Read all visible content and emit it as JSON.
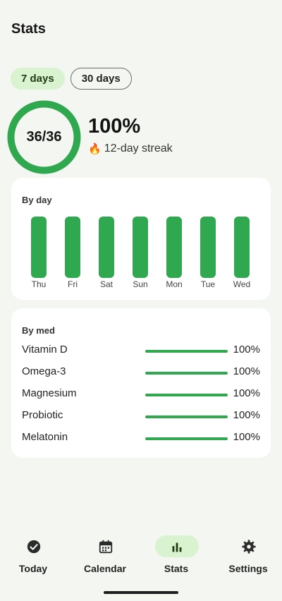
{
  "page": {
    "title": "Stats"
  },
  "range_tabs": [
    {
      "label": "7 days",
      "active": true
    },
    {
      "label": "30 days",
      "active": false
    }
  ],
  "summary": {
    "ring_label": "36/36",
    "taken": 36,
    "total": 36,
    "percent": "100%",
    "streak_icon": "fire-icon",
    "streak": "12-day streak"
  },
  "by_day": {
    "title": "By day",
    "days": [
      {
        "label": "Thu",
        "value": 1.0
      },
      {
        "label": "Fri",
        "value": 1.0
      },
      {
        "label": "Sat",
        "value": 1.0
      },
      {
        "label": "Sun",
        "value": 1.0
      },
      {
        "label": "Mon",
        "value": 1.0
      },
      {
        "label": "Tue",
        "value": 1.0
      },
      {
        "label": "Wed",
        "value": 1.0
      }
    ]
  },
  "by_med": {
    "title": "By med",
    "meds": [
      {
        "name": "Vitamin D",
        "percent": "100%",
        "value": 1.0
      },
      {
        "name": "Omega-3",
        "percent": "100%",
        "value": 1.0
      },
      {
        "name": "Magnesium",
        "percent": "100%",
        "value": 1.0
      },
      {
        "name": "Probiotic",
        "percent": "100%",
        "value": 1.0
      },
      {
        "name": "Melatonin",
        "percent": "100%",
        "value": 1.0
      }
    ]
  },
  "bottom_nav": [
    {
      "label": "Today",
      "icon": "check-circle-icon",
      "active": false
    },
    {
      "label": "Calendar",
      "icon": "calendar-icon",
      "active": false
    },
    {
      "label": "Stats",
      "icon": "bar-chart-icon",
      "active": true
    },
    {
      "label": "Settings",
      "icon": "gear-icon",
      "active": false
    }
  ],
  "colors": {
    "accent": "#2fa84f",
    "chip_active_bg": "#d9f2cf",
    "background": "#f3f6f1",
    "card": "#ffffff"
  }
}
